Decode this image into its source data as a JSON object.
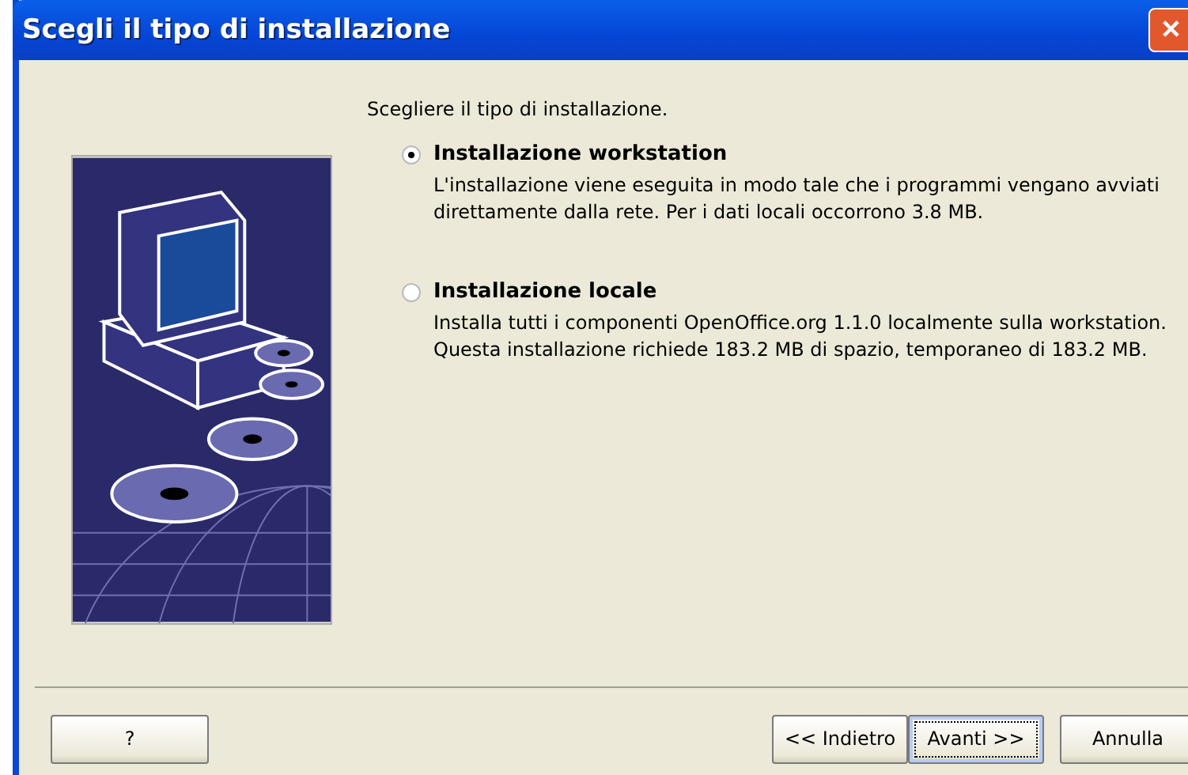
{
  "window": {
    "title": "Scegli il tipo di installazione",
    "close": "✕"
  },
  "heading": "Scegliere il tipo di installazione.",
  "options": [
    {
      "label": "Installazione workstation",
      "selected": true,
      "description": "L'installazione viene eseguita in modo tale che i programmi vengano avviati direttamente dalla rete. Per i dati locali occorrono 3.8 MB."
    },
    {
      "label": "Installazione locale",
      "selected": false,
      "description": "Installa tutti i componenti OpenOffice.org 1.1.0 localmente sulla workstation.  Questa installazione richiede 183.2 MB di spazio, temporaneo di 183.2 MB."
    }
  ],
  "buttons": [
    {
      "label": "?",
      "kind": "help",
      "focused": false
    },
    {
      "label": "<< Indietro",
      "kind": "nav",
      "focused": false
    },
    {
      "label": "Avanti >>",
      "kind": "nav",
      "focused": true
    },
    {
      "label": "Annulla",
      "kind": "cancel",
      "focused": false
    }
  ]
}
